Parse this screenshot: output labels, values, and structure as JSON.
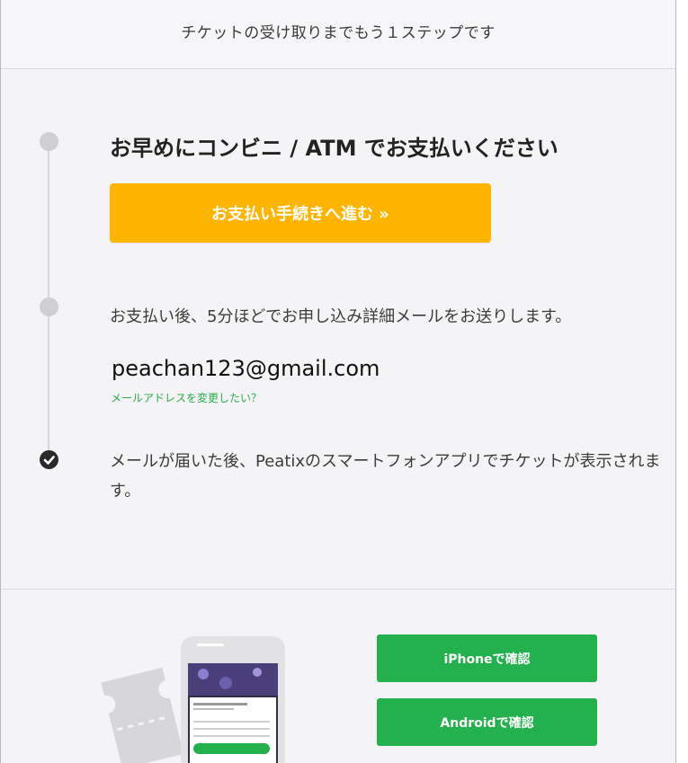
{
  "header": {
    "title": "チケットの受け取りまでもう１ステップです"
  },
  "step1": {
    "heading_prefix": "お早めにコンビニ / ",
    "heading_atm": "ATM",
    "heading_suffix": " でお支払いください",
    "button_label": "お支払い手続きへ進む »"
  },
  "step2": {
    "text": "お支払い後、5分ほどでお申し込み詳細メールをお送りします。",
    "email": "peachan123@gmail.com",
    "change_email_link": "メールアドレスを変更したい？"
  },
  "step3": {
    "text": "メールが届いた後、Peatixのスマートフォンアプリでチケットが表示されます。"
  },
  "app_buttons": {
    "iphone_label": "iPhoneで確認",
    "android_label": "Androidで確認"
  },
  "colors": {
    "pay_button": "#ffb400",
    "app_button": "#22b14c",
    "link": "#27ae48"
  },
  "icons": {
    "step_pending": "circle-icon",
    "step_done": "check-circle-icon"
  }
}
